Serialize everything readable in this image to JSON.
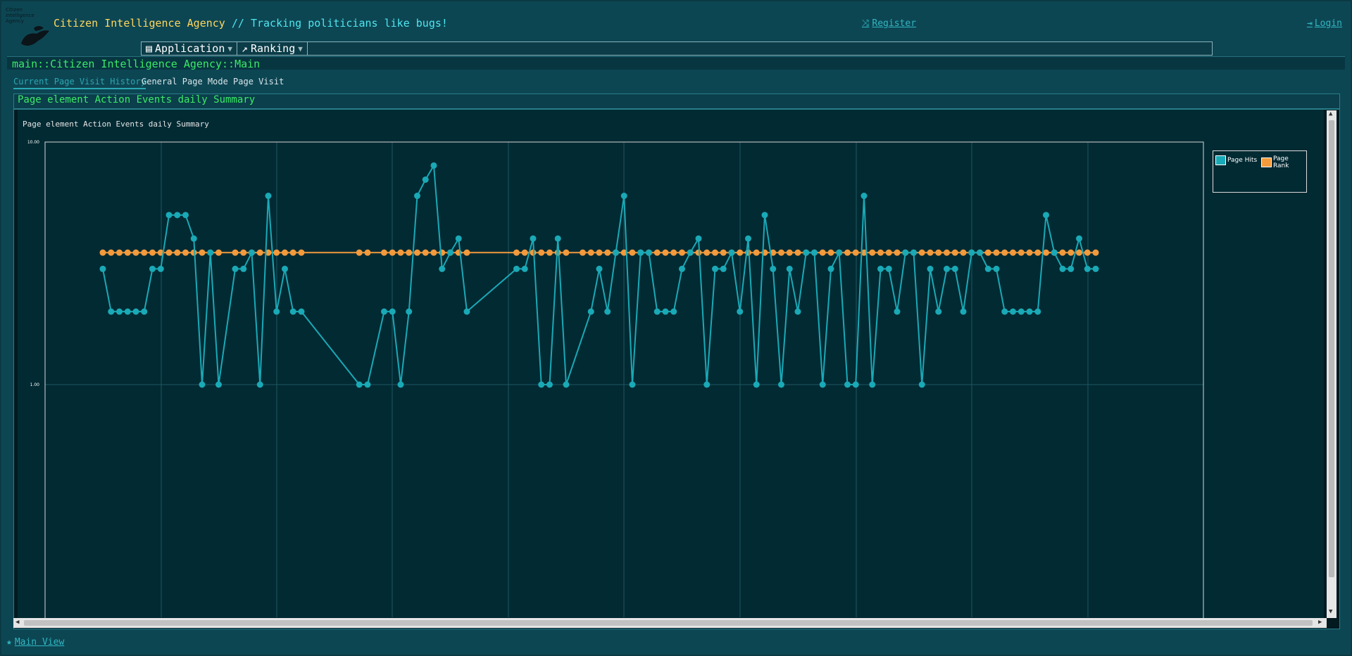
{
  "header": {
    "logo_text": "Citizen Intelligence Agency",
    "title_main": "Citizen Intelligence Agency",
    "title_sep": " // ",
    "title_sub": "Tracking politicians like bugs!",
    "register_label": "Register",
    "login_label": "Login"
  },
  "menu": {
    "items": [
      {
        "label": "Application",
        "icon": "document-icon"
      },
      {
        "label": "Ranking",
        "icon": "line-chart-icon"
      }
    ]
  },
  "breadcrumb": "main::Citizen Intelligence Agency::Main",
  "tabs": [
    {
      "label": "Current Page Visit History",
      "active": true
    },
    {
      "label": "General Page Mode Page Visit",
      "active": false
    }
  ],
  "panel": {
    "title": "Page element Action Events daily Summary"
  },
  "colors": {
    "page_hits": "#1aa9b6",
    "page_rank": "#f39a3c"
  },
  "chart_data": {
    "type": "line",
    "title": "Page element Action Events daily Summary",
    "y_scale": "log",
    "y_ticks": [
      "10.00",
      "1.00"
    ],
    "grid": true,
    "legend_placement": "top-right",
    "series": [
      {
        "name": "Page Hits",
        "points": [
          [
            1,
            3
          ],
          [
            2,
            2
          ],
          [
            3,
            2
          ],
          [
            4,
            2
          ],
          [
            5,
            2
          ],
          [
            6,
            2
          ],
          [
            7,
            3
          ],
          [
            8,
            3
          ],
          [
            9,
            5
          ],
          [
            10,
            5
          ],
          [
            11,
            5
          ],
          [
            12,
            4
          ],
          [
            13,
            1
          ],
          [
            14,
            3.5
          ],
          [
            15,
            1
          ],
          [
            17,
            3
          ],
          [
            18,
            3
          ],
          [
            19,
            3.5
          ],
          [
            20,
            1
          ],
          [
            21,
            6
          ],
          [
            22,
            2
          ],
          [
            23,
            3
          ],
          [
            24,
            2
          ],
          [
            25,
            2
          ],
          [
            32,
            1
          ],
          [
            33,
            1
          ],
          [
            35,
            2
          ],
          [
            36,
            2
          ],
          [
            37,
            1
          ],
          [
            38,
            2
          ],
          [
            39,
            6
          ],
          [
            40,
            7
          ],
          [
            41,
            8
          ],
          [
            42,
            3
          ],
          [
            43,
            3.5
          ],
          [
            44,
            4
          ],
          [
            45,
            2
          ],
          [
            51,
            3
          ],
          [
            52,
            3
          ],
          [
            53,
            4
          ],
          [
            54,
            1
          ],
          [
            55,
            1
          ],
          [
            56,
            4
          ],
          [
            57,
            1
          ],
          [
            60,
            2
          ],
          [
            61,
            3
          ],
          [
            62,
            2
          ],
          [
            63,
            3.5
          ],
          [
            64,
            6
          ],
          [
            65,
            1
          ],
          [
            66,
            3.5
          ],
          [
            67,
            3.5
          ],
          [
            68,
            2
          ],
          [
            69,
            2
          ],
          [
            70,
            2
          ],
          [
            71,
            3
          ],
          [
            72,
            3.5
          ],
          [
            73,
            4
          ],
          [
            74,
            1
          ],
          [
            75,
            3
          ],
          [
            76,
            3
          ],
          [
            77,
            3.5
          ],
          [
            78,
            2
          ],
          [
            79,
            4
          ],
          [
            80,
            1
          ],
          [
            81,
            5
          ],
          [
            82,
            3
          ],
          [
            83,
            1
          ],
          [
            84,
            3
          ],
          [
            85,
            2
          ],
          [
            86,
            3.5
          ],
          [
            87,
            3.5
          ],
          [
            88,
            1
          ],
          [
            89,
            3
          ],
          [
            90,
            3.5
          ],
          [
            91,
            1
          ],
          [
            92,
            1
          ],
          [
            93,
            6
          ],
          [
            94,
            1
          ],
          [
            95,
            3
          ],
          [
            96,
            3
          ],
          [
            97,
            2
          ],
          [
            98,
            3.5
          ],
          [
            99,
            3.5
          ],
          [
            100,
            1
          ],
          [
            101,
            3
          ],
          [
            102,
            2
          ],
          [
            103,
            3
          ],
          [
            104,
            3
          ],
          [
            105,
            2
          ],
          [
            106,
            3.5
          ],
          [
            107,
            3.5
          ],
          [
            108,
            3
          ],
          [
            109,
            3
          ],
          [
            110,
            2
          ],
          [
            111,
            2
          ],
          [
            112,
            2
          ],
          [
            113,
            2
          ],
          [
            114,
            2
          ],
          [
            115,
            5
          ],
          [
            116,
            3.5
          ],
          [
            117,
            3
          ],
          [
            118,
            3
          ],
          [
            119,
            4
          ],
          [
            120,
            3
          ],
          [
            121,
            3
          ]
        ]
      },
      {
        "name": "Page Rank",
        "value": 3.5,
        "x": [
          1,
          2,
          3,
          4,
          5,
          6,
          7,
          8,
          9,
          10,
          11,
          12,
          13,
          14,
          15,
          17,
          18,
          19,
          20,
          21,
          22,
          23,
          24,
          25,
          32,
          33,
          35,
          36,
          37,
          38,
          39,
          40,
          41,
          42,
          43,
          44,
          45,
          51,
          52,
          53,
          54,
          55,
          56,
          57,
          59,
          60,
          61,
          62,
          63,
          64,
          65,
          66,
          67,
          68,
          69,
          70,
          71,
          72,
          73,
          74,
          75,
          76,
          77,
          78,
          79,
          80,
          81,
          82,
          83,
          84,
          85,
          86,
          87,
          88,
          89,
          90,
          91,
          92,
          93,
          94,
          95,
          96,
          97,
          98,
          99,
          100,
          101,
          102,
          103,
          104,
          105,
          106,
          107,
          108,
          109,
          110,
          111,
          112,
          113,
          114,
          115,
          116,
          117,
          118,
          119,
          120,
          121
        ]
      }
    ]
  },
  "footer": {
    "label": "Main View"
  }
}
